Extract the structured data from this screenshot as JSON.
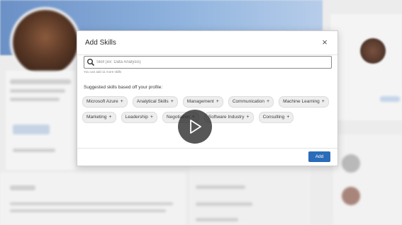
{
  "modal": {
    "title": "Add Skills",
    "close_icon": "×",
    "search": {
      "placeholder": "Skill (ex: Data Analysis)",
      "value": ""
    },
    "hint": "You can add 11 more skills",
    "suggest_heading": "Suggested skills based off your profile:",
    "chips": [
      "Microsoft Azure",
      "Analytical Skills",
      "Management",
      "Communication",
      "Machine Learning",
      "Marketing",
      "Leadership",
      "Negotiation",
      "Software Industry",
      "Consulting"
    ],
    "plus": "+",
    "add_label": "Add"
  },
  "video": {
    "play_icon": "play-icon"
  },
  "colors": {
    "accent": "#2b6cb8",
    "banner": "#7fa6d8",
    "overlay": "#2a2a2a"
  }
}
